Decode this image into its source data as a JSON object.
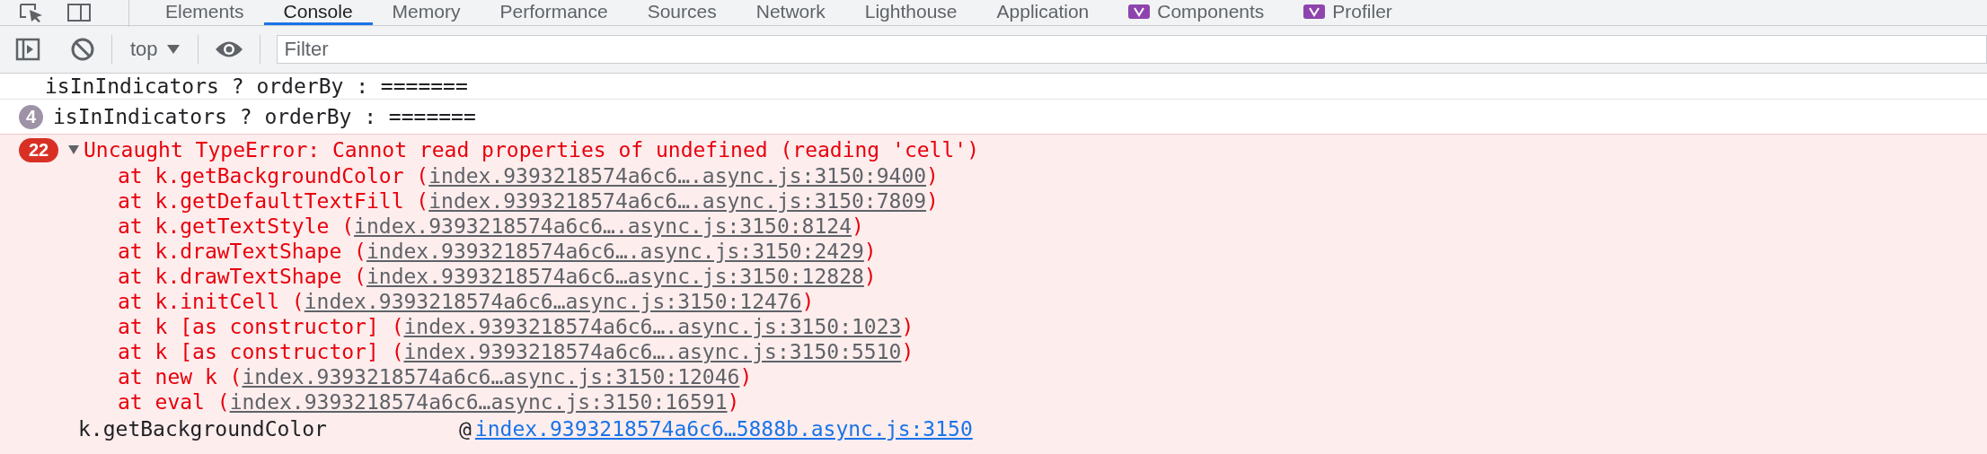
{
  "top_tabs": [
    {
      "label": "Elements",
      "selected": false,
      "kind": "plain"
    },
    {
      "label": "Console",
      "selected": true,
      "kind": "plain"
    },
    {
      "label": "Memory",
      "selected": false,
      "kind": "plain"
    },
    {
      "label": "Performance",
      "selected": false,
      "kind": "plain"
    },
    {
      "label": "Sources",
      "selected": false,
      "kind": "plain"
    },
    {
      "label": "Network",
      "selected": false,
      "kind": "plain"
    },
    {
      "label": "Lighthouse",
      "selected": false,
      "kind": "plain"
    },
    {
      "label": "Application",
      "selected": false,
      "kind": "plain"
    },
    {
      "label": "Components",
      "selected": false,
      "kind": "extension"
    },
    {
      "label": "Profiler",
      "selected": false,
      "kind": "extension"
    }
  ],
  "toolbar": {
    "context": "top",
    "filter": {
      "placeholder": "Filter"
    }
  },
  "console": {
    "partial_message": {
      "text": "isInIndicators ? orderBy : ======="
    },
    "log_message": {
      "count": "4",
      "text": "isInIndicators ? orderBy : ======="
    },
    "error": {
      "count": "22",
      "expanded": true,
      "message": "Uncaught TypeError: Cannot read properties of undefined (reading 'cell')",
      "stack": [
        {
          "prefix": "at k.getBackgroundColor (",
          "location": "index.9393218574a6c6….async.js:3150:9400",
          "suffix": ")"
        },
        {
          "prefix": "at k.getDefaultTextFill (",
          "location": "index.9393218574a6c6….async.js:3150:7809",
          "suffix": ")"
        },
        {
          "prefix": "at k.getTextStyle (",
          "location": "index.9393218574a6c6….async.js:3150:8124",
          "suffix": ")"
        },
        {
          "prefix": "at k.drawTextShape (",
          "location": "index.9393218574a6c6….async.js:3150:2429",
          "suffix": ")"
        },
        {
          "prefix": "at k.drawTextShape (",
          "location": "index.9393218574a6c6…async.js:3150:12828",
          "suffix": ")"
        },
        {
          "prefix": "at k.initCell (",
          "location": "index.9393218574a6c6…async.js:3150:12476",
          "suffix": ")"
        },
        {
          "prefix": "at k [as constructor] (",
          "location": "index.9393218574a6c6….async.js:3150:1023",
          "suffix": ")"
        },
        {
          "prefix": "at k [as constructor] (",
          "location": "index.9393218574a6c6….async.js:3150:5510",
          "suffix": ")"
        },
        {
          "prefix": "at new k (",
          "location": "index.9393218574a6c6…async.js:3150:12046",
          "suffix": ")"
        },
        {
          "prefix": "at eval (",
          "location": "index.9393218574a6c6…async.js:3150:16591",
          "suffix": ")"
        }
      ],
      "source": {
        "function": "k.getBackgroundColor",
        "at": "@",
        "location": "index.9393218574a6c6…5888b.async.js:3150"
      }
    }
  }
}
